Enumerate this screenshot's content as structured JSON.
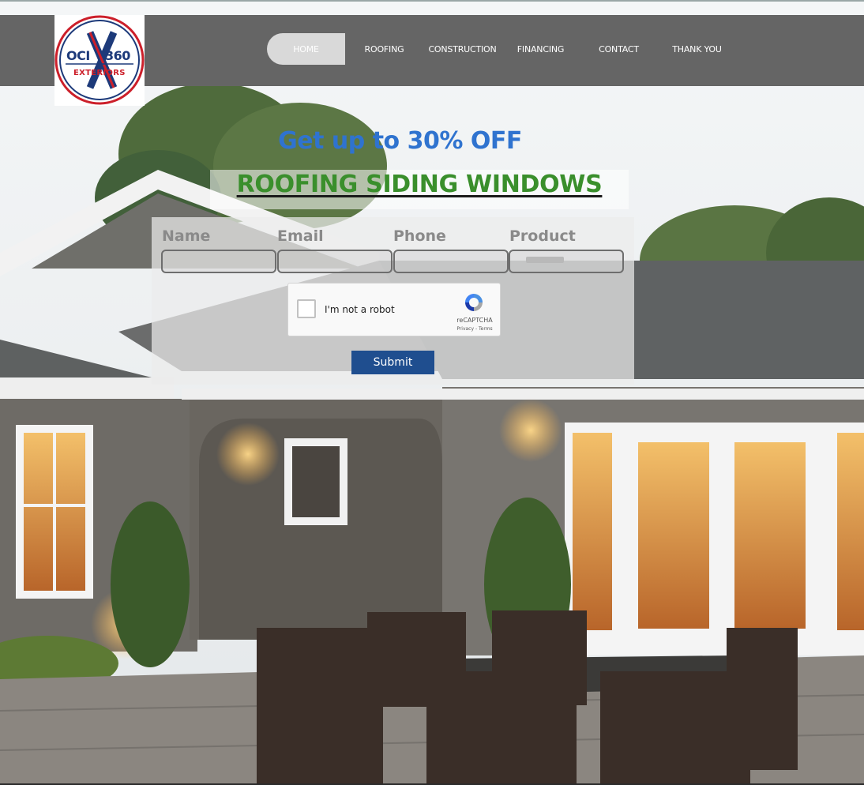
{
  "brand": {
    "logo_top": "OCI",
    "logo_number": "360",
    "logo_bottom": "EXTERIORS"
  },
  "nav": {
    "items": [
      {
        "label": "HOME",
        "active": true
      },
      {
        "label": "ROOFING"
      },
      {
        "label": "CONSTRUCTION"
      },
      {
        "label": "FINANCING"
      },
      {
        "label": "CONTACT"
      },
      {
        "label": "THANK YOU"
      }
    ]
  },
  "hero": {
    "headline": "Get up to 30% OFF",
    "subheadline": "ROOFING SIDING WINDOWS"
  },
  "form": {
    "fields": [
      {
        "label": "Name",
        "value": ""
      },
      {
        "label": "Email",
        "value": ""
      },
      {
        "label": "Phone",
        "value": ""
      },
      {
        "label": "Product",
        "value": ""
      }
    ],
    "recaptcha": {
      "label": "I'm not a robot",
      "brand": "reCAPTCHA",
      "links": "Privacy - Terms"
    },
    "submit_label": "Submit"
  },
  "colors": {
    "header_bg": "#656565",
    "headline": "#2f73cf",
    "subheadline": "#3a8f2c",
    "submit_bg": "#1f4e8f",
    "logo_red": "#cc1f2a",
    "logo_blue": "#1d3a7a"
  }
}
